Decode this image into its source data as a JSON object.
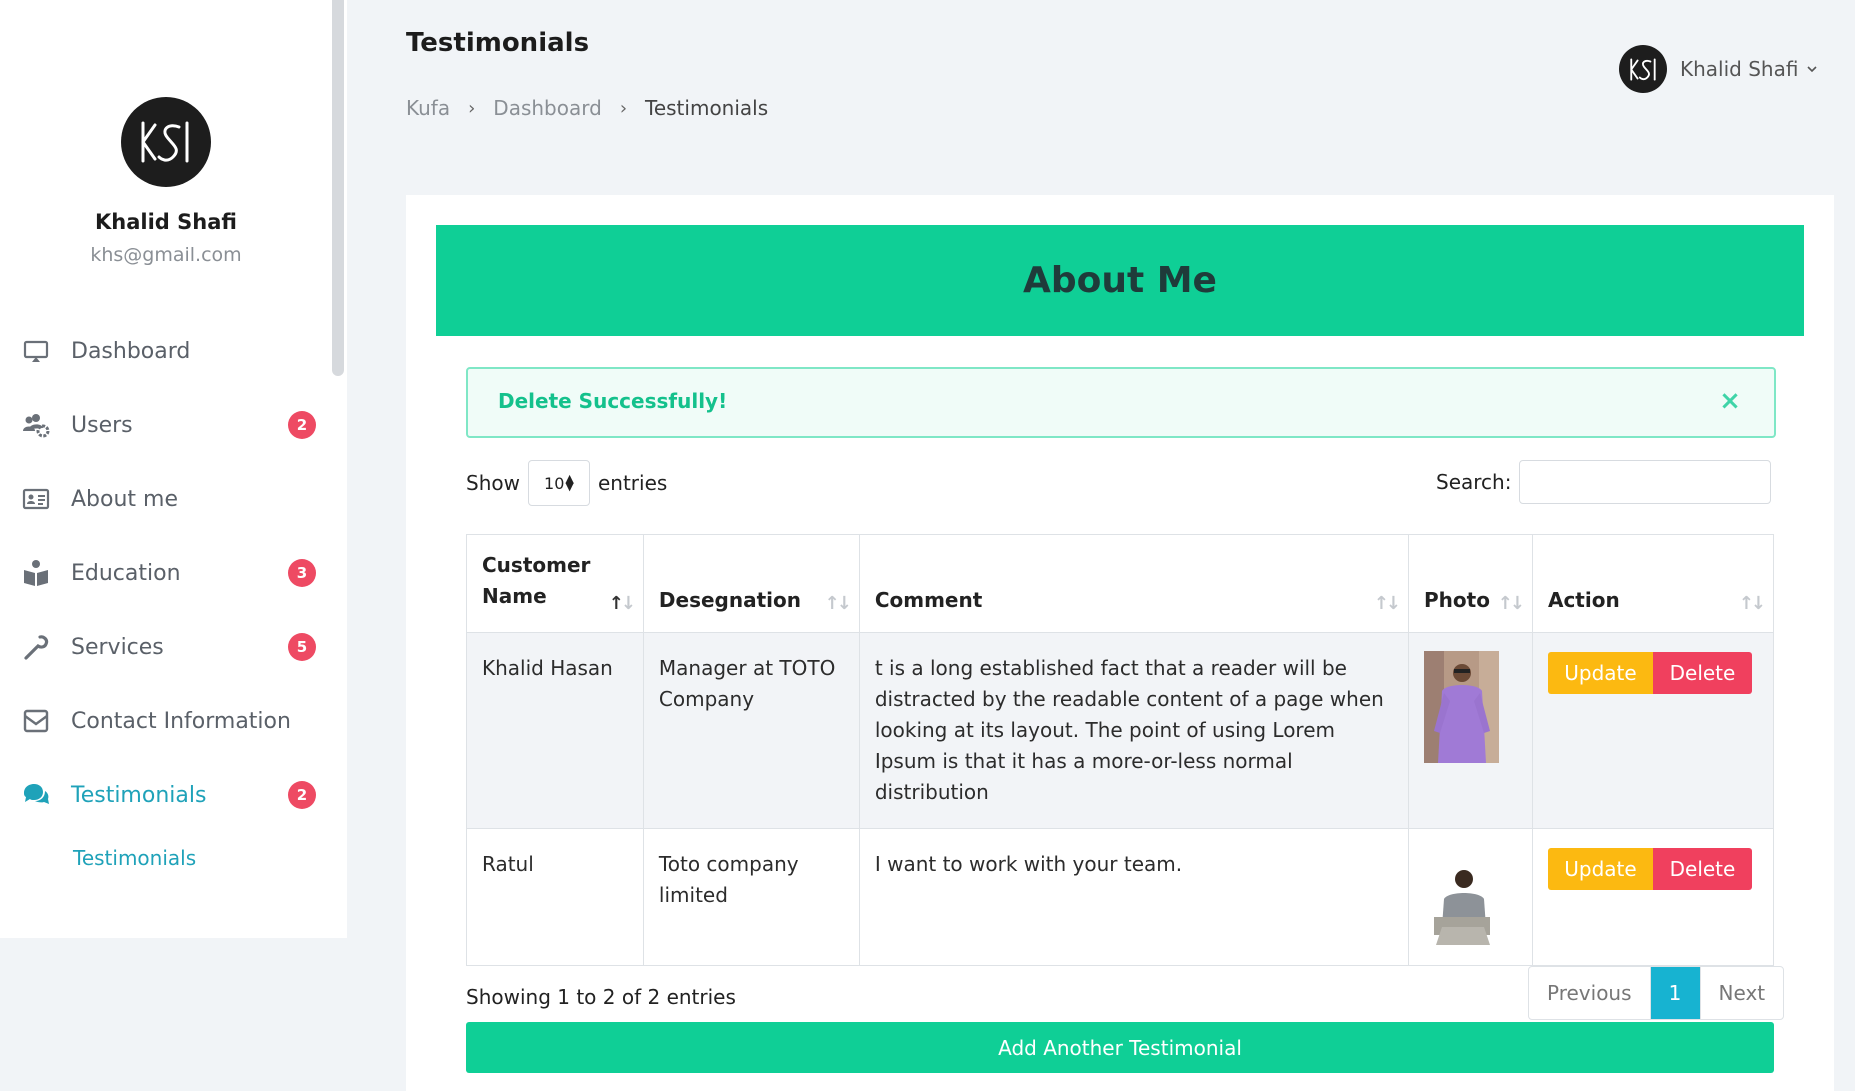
{
  "page": {
    "title": "Testimonials",
    "breadcrumb": [
      "Kufa",
      "Dashboard",
      "Testimonials"
    ]
  },
  "user_menu": {
    "name": "Khalid Shafi"
  },
  "profile": {
    "name": "Khalid Shafi",
    "email": "khs@gmail.com",
    "logo_text": "KS"
  },
  "sidebar": {
    "items": [
      {
        "label": "Dashboard",
        "icon": "monitor-icon",
        "badge": null
      },
      {
        "label": "Users",
        "icon": "users-cog-icon",
        "badge": "2"
      },
      {
        "label": "About me",
        "icon": "id-card-icon",
        "badge": null
      },
      {
        "label": "Education",
        "icon": "book-reader-icon",
        "badge": "3"
      },
      {
        "label": "Services",
        "icon": "wrench-icon",
        "badge": "5"
      },
      {
        "label": "Contact Information",
        "icon": "envelope-icon",
        "badge": null
      },
      {
        "label": "Testimonials",
        "icon": "comments-icon",
        "badge": "2"
      }
    ],
    "active_sub": "Testimonials"
  },
  "card": {
    "header": "About Me",
    "alert": "Delete Successfully!",
    "length": {
      "prefix": "Show",
      "value": "10",
      "suffix": "entries"
    },
    "search_label": "Search:",
    "columns": [
      "Customer Name",
      "Desegnation",
      "Comment",
      "Photo",
      "Action"
    ],
    "rows": [
      {
        "name": "Khalid Hasan",
        "designation": "Manager at TOTO Company",
        "comment": "t is a long established fact that a reader will be distracted by the readable content of a page when looking at its layout. The point of using Lorem Ipsum is that it has a more-or-less normal distribution",
        "update_label": "Update",
        "delete_label": "Delete"
      },
      {
        "name": "Ratul",
        "designation": "Toto company limited",
        "comment": "I want to work with your team.",
        "update_label": "Update",
        "delete_label": "Delete"
      }
    ],
    "info": "Showing 1 to 2 of 2 entries",
    "pager": {
      "previous": "Previous",
      "current": "1",
      "next": "Next"
    },
    "add_button": "Add Another Testimonial"
  },
  "colors": {
    "accent_green": "#0fcf96",
    "active_teal": "#1fa2b9",
    "badge_red": "#ee4a63",
    "update_yellow": "#fcb911",
    "delete_red": "#f0405e",
    "pager_active": "#17b3d1"
  }
}
